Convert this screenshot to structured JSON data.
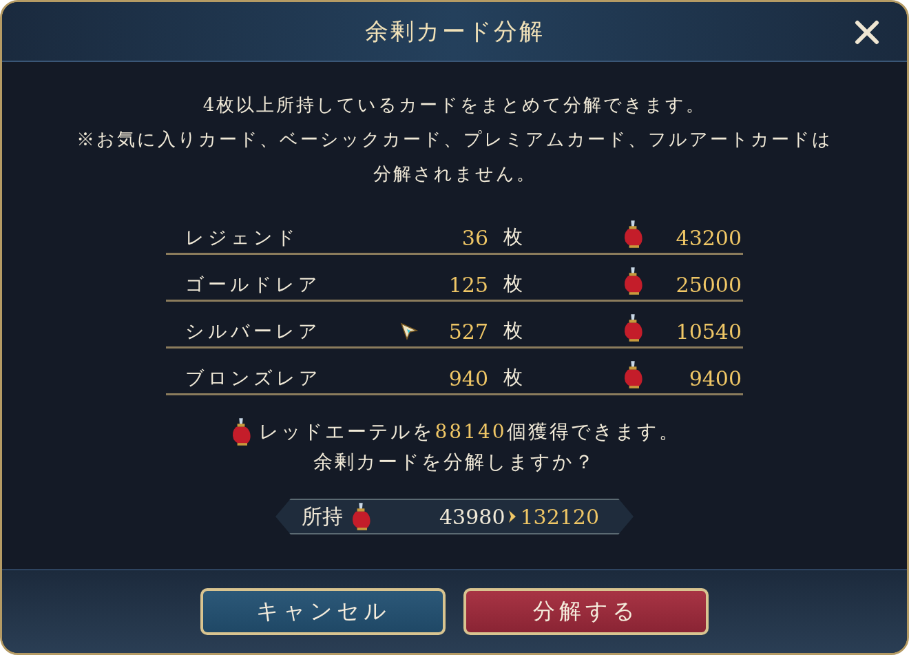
{
  "dialog": {
    "title": "余剰カード分解"
  },
  "description": [
    "4枚以上所持しているカードをまとめて分解できます。",
    "※お気に入りカード、ベーシックカード、プレミアムカード、フルアートカードは",
    "分解されません。"
  ],
  "rows": [
    {
      "rarity": "レジェンド",
      "count": "36",
      "unit": "枚",
      "yield": "43200"
    },
    {
      "rarity": "ゴールドレア",
      "count": "125",
      "unit": "枚",
      "yield": "25000"
    },
    {
      "rarity": "シルバーレア",
      "count": "527",
      "unit": "枚",
      "yield": "10540"
    },
    {
      "rarity": "ブロンズレア",
      "count": "940",
      "unit": "枚",
      "yield": "9400"
    }
  ],
  "summary": {
    "before": "レッドエーテルを",
    "amount": "88140",
    "after": "個獲得できます。",
    "question": "余剰カードを分解しますか？"
  },
  "owned": {
    "label": "所持",
    "current": "43980",
    "result": "132120"
  },
  "buttons": [
    {
      "label": "キャンセル",
      "kind": "cancel"
    },
    {
      "label": "分解する",
      "kind": "confirm"
    }
  ]
}
